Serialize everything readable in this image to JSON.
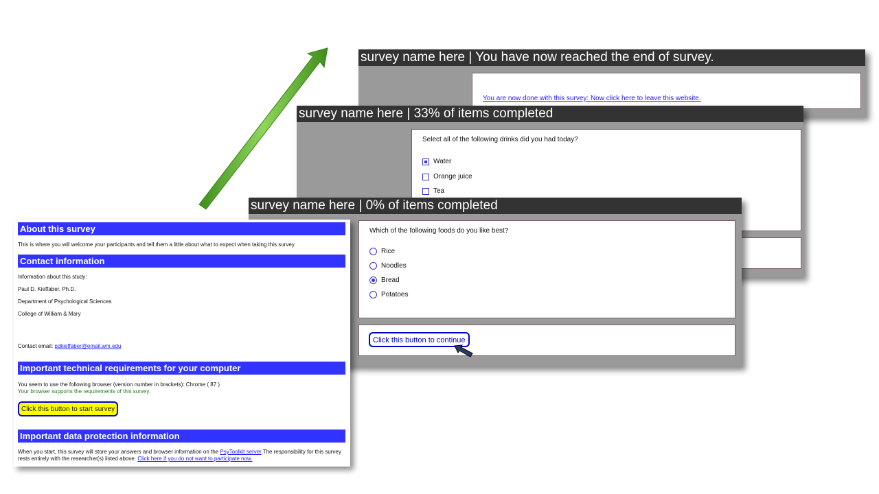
{
  "end_screen": {
    "title": "survey name here | You have now reached the end of survey.",
    "link": "You are now done with this survey: Now click here to leave this website."
  },
  "drinks_screen": {
    "title": "survey name here | 33% of items completed",
    "question": "Select all of the following drinks did you had today?",
    "options": [
      {
        "label": "Water",
        "checked": true
      },
      {
        "label": "Orange juice",
        "checked": false
      },
      {
        "label": "Tea",
        "checked": false
      }
    ]
  },
  "foods_screen": {
    "title": "survey name here | 0% of items completed",
    "question": "Which of the following foods do you like best?",
    "options": [
      {
        "label": "Rice",
        "selected": false
      },
      {
        "label": "Noodles",
        "selected": false
      },
      {
        "label": "Bread",
        "selected": true
      },
      {
        "label": "Potatoes",
        "selected": false
      }
    ],
    "continue_label": "Click this button to continue"
  },
  "intro_page": {
    "about_heading": "About this survey",
    "about_text": "This is where you will welcome your participants and tell them a little about what to expect when taking this survey.",
    "contact_heading": "Contact information",
    "contact_lines": [
      "Information about this study:",
      "Paul D. Kieffaber, Ph.D.",
      "Department of Psychological Sciences",
      "College of William & Mary"
    ],
    "contact_email_label": "Contact email:",
    "contact_email": "pdkieffaber@email.wm.edu",
    "tech_heading": "Important technical requirements for your computer",
    "browser_text": "You seem to use the following browser (version number in brackets): Chrome ( 87 )",
    "browser_ok": "Your browser supports the requirements of this survey.",
    "start_label": "Click this button to start survey",
    "privacy_heading": "Important data protection information",
    "privacy_text_1": "When you start, this survey will store your answers and browser information on the",
    "privacy_link": "PsyToolkit server",
    "privacy_text_2": ".The responsibility for this survey rests entirely with the researcher(s) listed above.",
    "opt_out_link": "Click here if you do not want to participate now."
  },
  "colors": {
    "header_blue": "#3333ff",
    "titlebar": "#333333",
    "arrow_green": "#5cb82e",
    "start_yellow": "#ffff00"
  }
}
